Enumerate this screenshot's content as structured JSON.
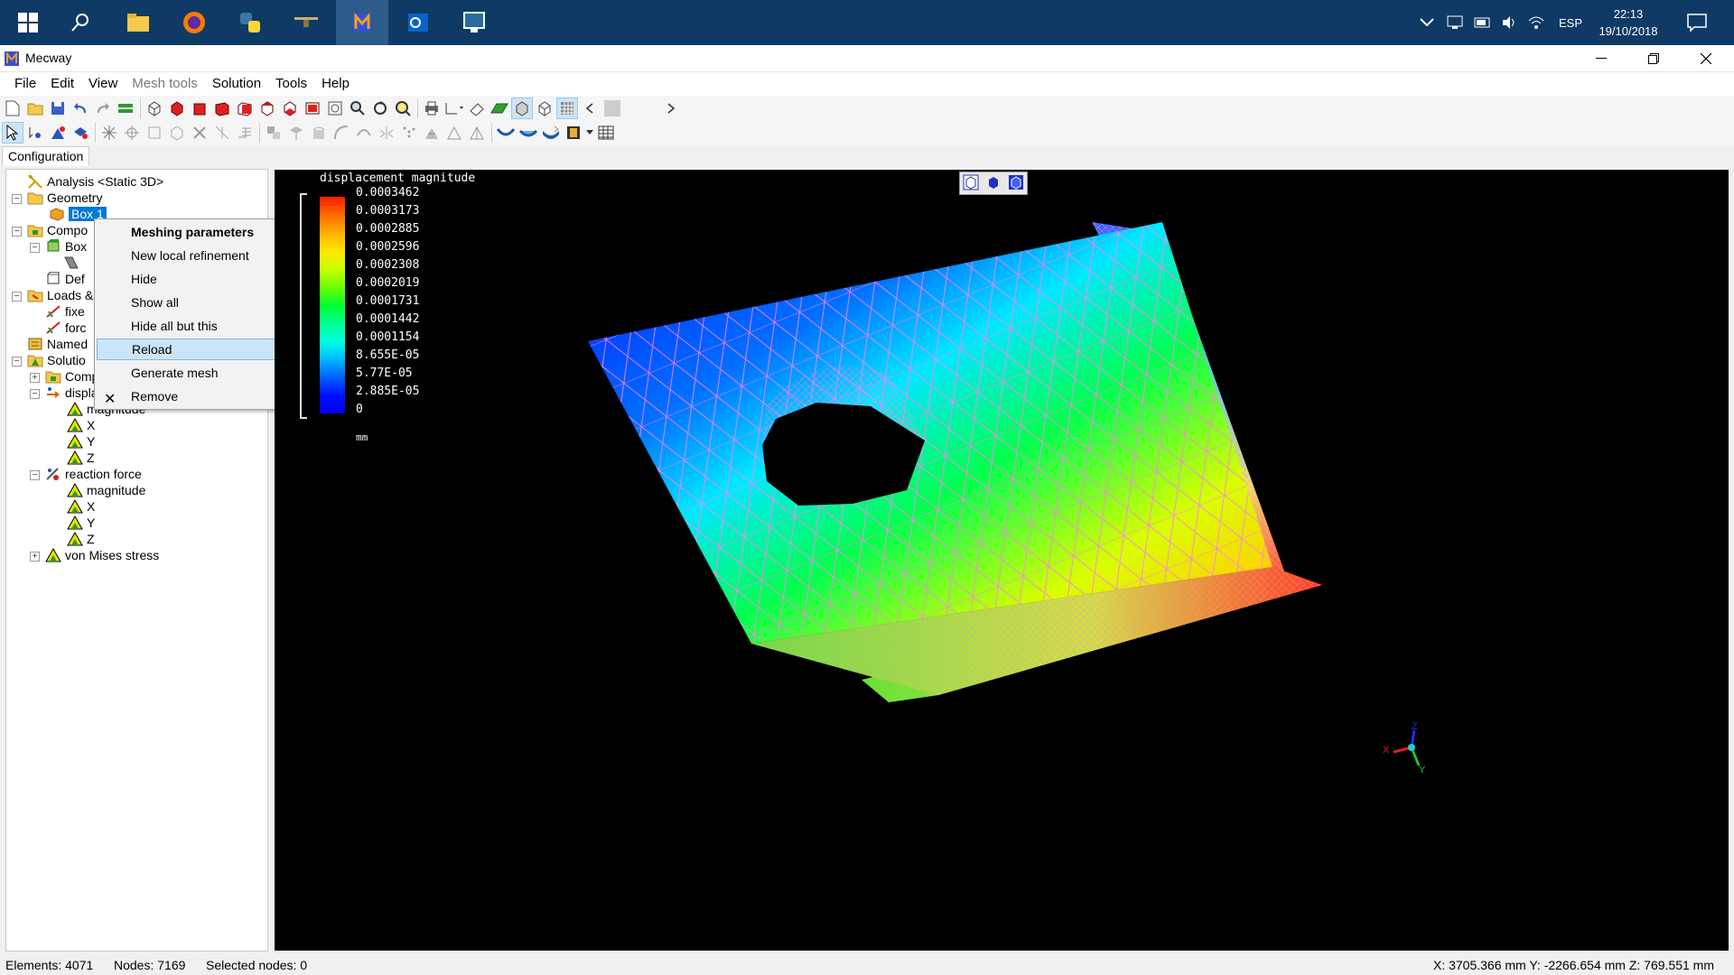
{
  "taskbar": {
    "tray_language": "ESP",
    "clock_time": "22:13",
    "clock_date": "19/10/2018"
  },
  "window": {
    "title": "Mecway"
  },
  "menu": {
    "file": "File",
    "edit": "Edit",
    "view": "View",
    "mesh_tools": "Mesh tools",
    "solution": "Solution",
    "tools": "Tools",
    "help": "Help"
  },
  "panel": {
    "tab": "Configuration"
  },
  "tree": {
    "analysis": "Analysis <Static 3D>",
    "geometry": "Geometry",
    "box1": "Box 1",
    "components": "Compo",
    "box": "Box",
    "def": "Def",
    "loads": "Loads &",
    "fixed": "fixe",
    "force": "forc",
    "named": "Named",
    "solution": "Solutio",
    "sol_components": "Components",
    "displacement": "displacement",
    "disp_magnitude": "magnitude",
    "disp_x": "X",
    "disp_y": "Y",
    "disp_z": "Z",
    "reaction_force": "reaction force",
    "rf_magnitude": "magnitude",
    "rf_x": "X",
    "rf_y": "Y",
    "rf_z": "Z",
    "von_mises": "von Mises stress"
  },
  "context_menu": {
    "meshing_parameters": "Meshing parameters",
    "new_local_refinement": "New local refinement",
    "hide": "Hide",
    "show_all": "Show all",
    "hide_all_but_this": "Hide all but this",
    "reload": "Reload",
    "generate_mesh": "Generate mesh",
    "remove": "Remove"
  },
  "legend": {
    "title": "displacement magnitude",
    "values": [
      "0.0003462",
      "0.0003173",
      "0.0002885",
      "0.0002596",
      "0.0002308",
      "0.0002019",
      "0.0001731",
      "0.0001442",
      "0.0001154",
      "8.655E-05",
      "5.77E-05",
      "2.885E-05",
      "0"
    ],
    "unit": "mm"
  },
  "triad": {
    "x": "X",
    "y": "Y",
    "z": "Z"
  },
  "status": {
    "elements": "Elements: 4071",
    "nodes": "Nodes: 7169",
    "selected_nodes": "Selected nodes: 0",
    "coords": "X: 3705.366 mm Y: -2266.654 mm Z: 769.551 mm"
  },
  "colors": {
    "taskbar": "#0f3a66",
    "selection": "#0078d7",
    "mesh_lines": "#ff7ff0",
    "viewport_bg": "#000000"
  }
}
